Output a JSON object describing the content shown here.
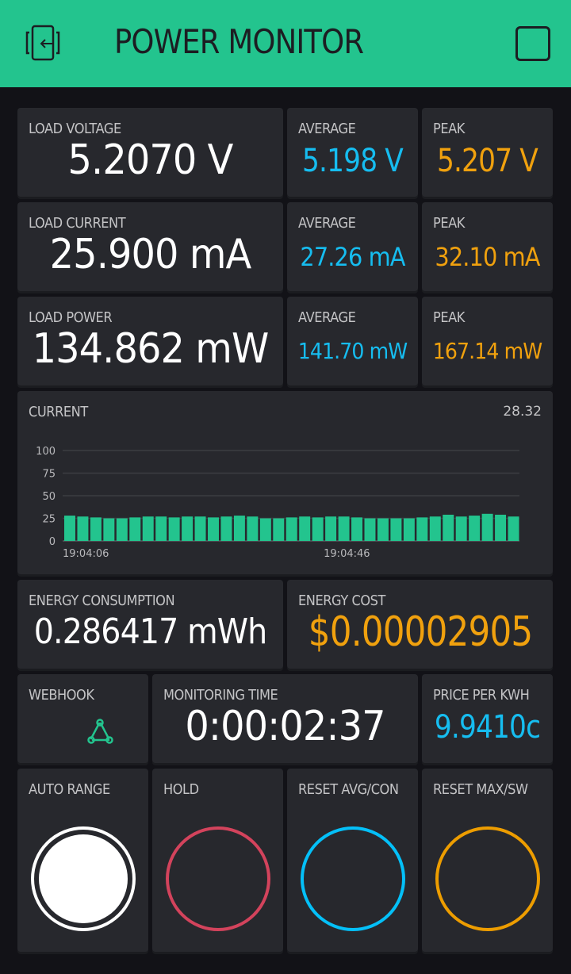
{
  "header": {
    "title": "POWER MONITOR",
    "back_icon": "exit-device-icon",
    "right_icon": "square-icon",
    "color": "#23c48e"
  },
  "colors": {
    "average": "#16bdf0",
    "peak": "#f0a10e",
    "chart_bar": "#23c48e",
    "hold": "#d3435c",
    "reset_avg": "#04c0f8",
    "reset_max": "#ed9d00"
  },
  "voltage": {
    "label": "LOAD VOLTAGE",
    "value": "5.2070 V",
    "avg_label": "AVERAGE",
    "avg_value": "5.198 V",
    "peak_label": "PEAK",
    "peak_value": "5.207 V"
  },
  "current": {
    "label": "LOAD CURRENT",
    "value": "25.900 mA",
    "avg_label": "AVERAGE",
    "avg_value": "27.26 mA",
    "peak_label": "PEAK",
    "peak_value": "32.10 mA"
  },
  "power": {
    "label": "LOAD POWER",
    "value": "134.862 mW",
    "avg_label": "AVERAGE",
    "avg_value": "141.70 mW",
    "peak_label": "PEAK",
    "peak_value": "167.14 mW"
  },
  "chart": {
    "label": "CURRENT",
    "latest": "28.32"
  },
  "chart_data": {
    "type": "bar",
    "title": "CURRENT",
    "xlabel": "",
    "ylabel": "",
    "ylim": [
      0,
      100
    ],
    "yticks": [
      0,
      25,
      50,
      75,
      100
    ],
    "xtick_labels": [
      {
        "index": 0,
        "label": "19:04:06"
      },
      {
        "index": 20,
        "label": "19:04:46"
      }
    ],
    "grid": true,
    "values": [
      28,
      27,
      26,
      25,
      25,
      26,
      27,
      27,
      26,
      27,
      27,
      26,
      27,
      28,
      27,
      25,
      25,
      26,
      27,
      26,
      27,
      27,
      26,
      25,
      25,
      25,
      25,
      26,
      27,
      29,
      27,
      28,
      30,
      29,
      27
    ]
  },
  "energy": {
    "label": "ENERGY CONSUMPTION",
    "value": "0.286417 mWh",
    "cost_label": "ENERGY COST",
    "cost_value": "$0.00002905"
  },
  "webhook": {
    "label": "WEBHOOK",
    "icon": "webhook-icon"
  },
  "monitoring": {
    "label": "MONITORING TIME",
    "value": "0:00:02:37"
  },
  "price": {
    "label": "PRICE PER KWH",
    "value": "9.9410c"
  },
  "buttons": [
    {
      "label": "AUTO RANGE",
      "state": "on"
    },
    {
      "label": "HOLD",
      "state": "off"
    },
    {
      "label": "RESET AVG/CON",
      "state": "off"
    },
    {
      "label": "RESET MAX/SW",
      "state": "off"
    }
  ]
}
